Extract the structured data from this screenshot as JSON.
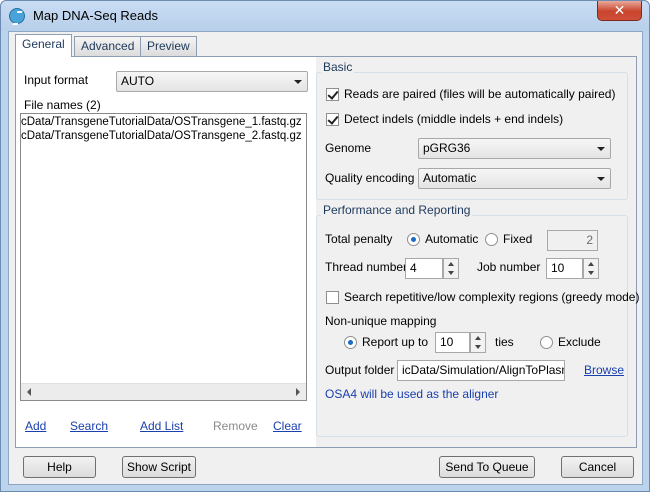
{
  "window": {
    "title": "Map DNA-Seq Reads",
    "close_symbol": "✕"
  },
  "tabs": [
    {
      "label": "General",
      "active": true
    },
    {
      "label": "Advanced",
      "active": false
    },
    {
      "label": "Preview",
      "active": false
    }
  ],
  "input": {
    "format_label": "Input format",
    "format_value": "AUTO",
    "file_names_label": "File names (2)",
    "files": [
      "cData/TransgeneTutorialData/OSTransgene_1.fastq.gz",
      "cData/TransgeneTutorialData/OSTransgene_2.fastq.gz"
    ]
  },
  "file_actions": {
    "add": "Add",
    "search": "Search",
    "add_list": "Add List",
    "remove": "Remove",
    "clear": "Clear"
  },
  "basic": {
    "title": "Basic",
    "reads_paired": "Reads are paired (files will be automatically paired)",
    "detect_indels": "Detect indels (middle indels + end indels)",
    "genome_label": "Genome",
    "genome_value": "pGRG36",
    "quality_label": "Quality encoding",
    "quality_value": "Automatic"
  },
  "performance": {
    "title": "Performance and Reporting",
    "total_penalty_label": "Total penalty",
    "penalty_automatic": "Automatic",
    "penalty_fixed": "Fixed",
    "penalty_fixed_value": "2",
    "thread_label": "Thread number",
    "thread_value": "4",
    "job_label": "Job number",
    "job_value": "10",
    "search_repetitive": "Search repetitive/low complexity regions (greedy mode)",
    "non_unique_label": "Non-unique mapping",
    "report_up_to": "Report up to",
    "report_value": "10",
    "ties": "ties",
    "exclude": "Exclude",
    "output_folder_label": "Output folder",
    "output_folder_value": "icData/Simulation/AlignToPlasmid",
    "browse": "Browse",
    "aligner_note": "OSA4 will be used as the aligner"
  },
  "footer": {
    "help": "Help",
    "show_script": "Show Script",
    "send_to_queue": "Send To Queue",
    "cancel": "Cancel"
  }
}
